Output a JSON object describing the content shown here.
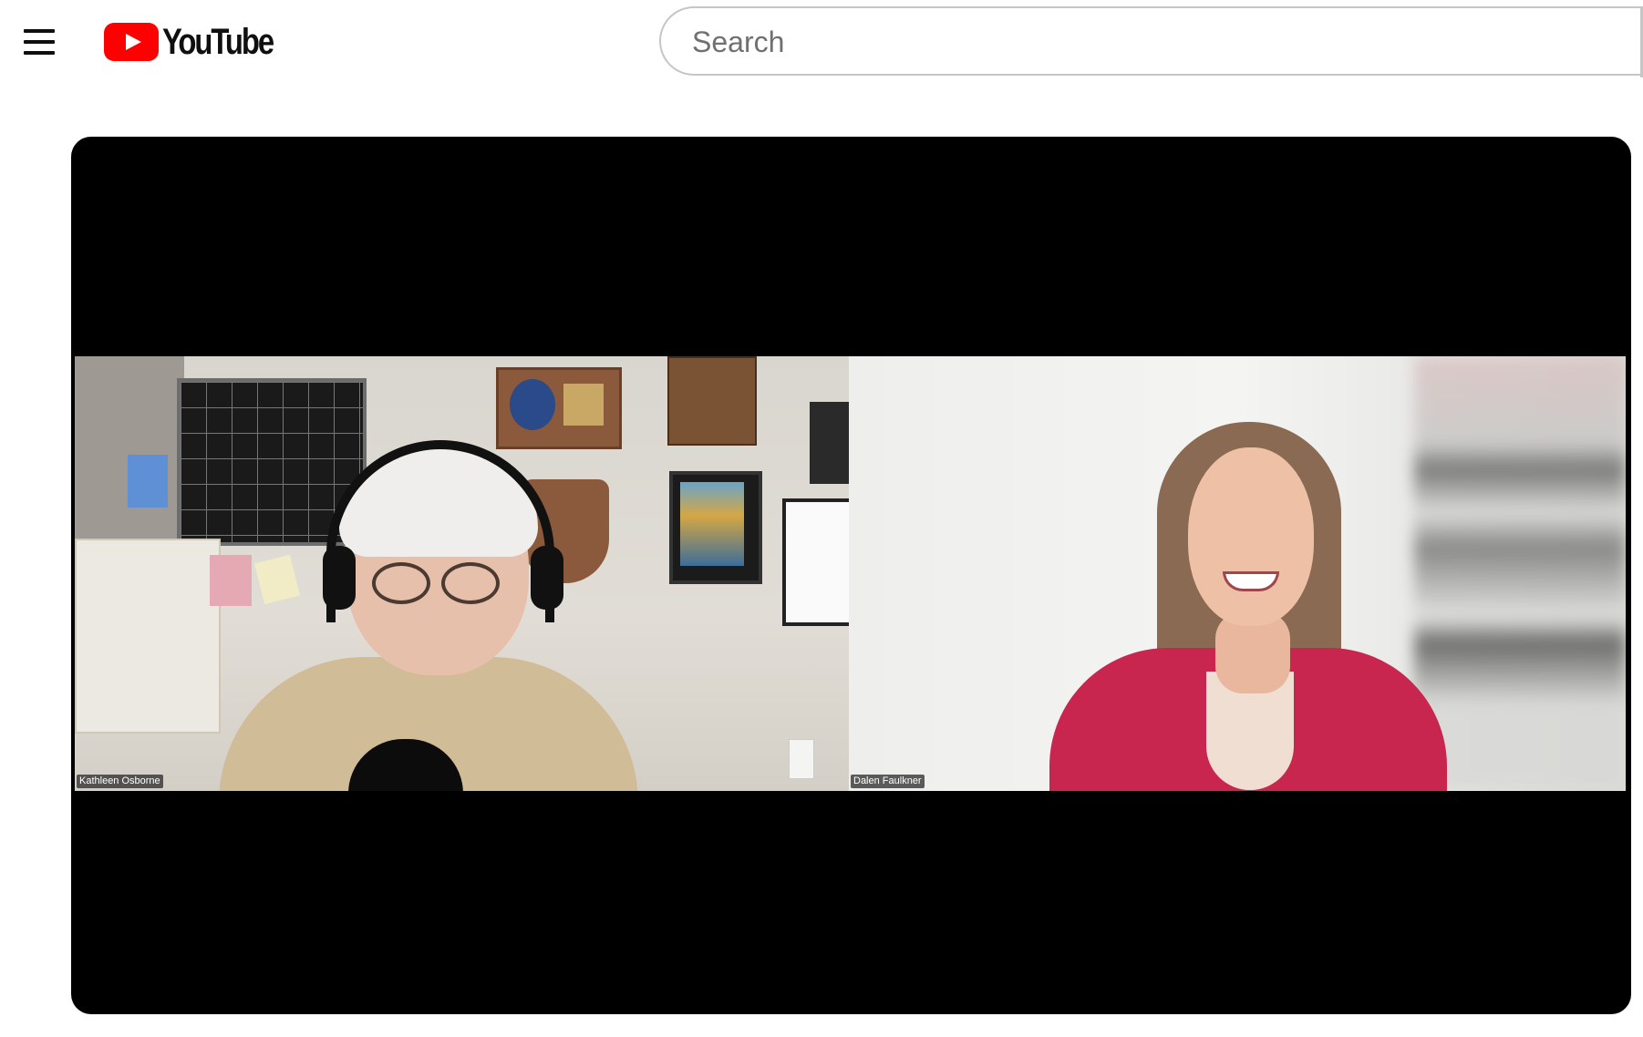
{
  "header": {
    "logo_text": "YouTube",
    "search": {
      "placeholder": "Search",
      "value": ""
    },
    "icons": {
      "menu": "hamburger-menu-icon",
      "logo": "youtube-play-icon"
    }
  },
  "player": {
    "participants": [
      {
        "name": "Kathleen Osborne"
      },
      {
        "name": "Dalen Faulkner"
      }
    ]
  },
  "colors": {
    "brand": "#ff0000",
    "background": "#ffffff",
    "player_background": "#000000"
  }
}
